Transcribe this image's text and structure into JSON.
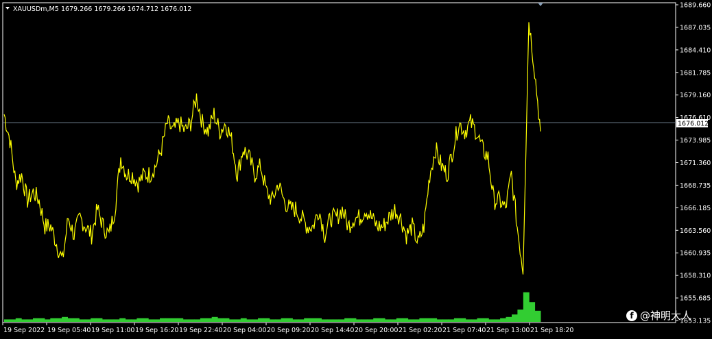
{
  "header": {
    "symbol_label": "XAUUSDm,M5",
    "ohlc": "1679.266 1679.266 1674.712 1676.012",
    "collapse_icon": "triangle-down-icon"
  },
  "watermark": {
    "icon": "facebook-icon",
    "text": "@神明大人"
  },
  "colors": {
    "background": "#000000",
    "price_line": "#FFFF00",
    "volume": "#32CD32",
    "grid_frame": "#FFFFFF",
    "current_price_line": "#708090"
  },
  "chart_data": {
    "type": "line",
    "title": "XAUUSDm,M5",
    "current_price": 1676.012,
    "ylim": [
      1653.1,
      1689.66
    ],
    "y_ticks": [
      "1689.660",
      "1687.035",
      "1684.410",
      "1681.785",
      "1679.160",
      "1676.610",
      "1673.985",
      "1671.360",
      "1668.735",
      "1666.185",
      "1663.560",
      "1660.935",
      "1658.310",
      "1655.685",
      "1653.135"
    ],
    "x_ticks": [
      "19 Sep 2022",
      "19 Sep 05:40",
      "19 Sep 11:00",
      "19 Sep 16:20",
      "19 Sep 22:40",
      "20 Sep 04:00",
      "20 Sep 09:20",
      "20 Sep 14:40",
      "20 Sep 20:00",
      "21 Sep 02:20",
      "21 Sep 07:40",
      "21 Sep 13:00",
      "21 Sep 18:20"
    ],
    "series": [
      {
        "values": [
          1677,
          1674,
          1669,
          1670,
          1667,
          1668,
          1667,
          1664,
          1664,
          1662,
          1660,
          1665,
          1663,
          1665,
          1664,
          1663,
          1666,
          1664,
          1663,
          1666,
          1672,
          1670,
          1670,
          1669,
          1670,
          1670,
          1671,
          1673,
          1676,
          1675,
          1676,
          1675,
          1676,
          1679,
          1676,
          1675,
          1677,
          1675,
          1676,
          1674,
          1670,
          1673,
          1672,
          1670,
          1671,
          1668,
          1667,
          1669,
          1667,
          1666,
          1666,
          1665,
          1664,
          1664,
          1666,
          1663,
          1665,
          1665,
          1666,
          1664,
          1665,
          1665,
          1666,
          1665,
          1664,
          1664,
          1665,
          1666,
          1665,
          1663,
          1664,
          1662,
          1664,
          1670,
          1673,
          1671,
          1670,
          1673,
          1676,
          1675,
          1676,
          1675,
          1673,
          1672,
          1667,
          1667,
          1666,
          1670,
          1664,
          1659,
          1688,
          1682,
          1675
        ],
        "x_start": 0,
        "x_end": 785
      }
    ],
    "volume_series": [
      2,
      2,
      3,
      2,
      2,
      3,
      3,
      2,
      3,
      3,
      4,
      3,
      3,
      2,
      2,
      3,
      3,
      2,
      2,
      2,
      3,
      2,
      2,
      3,
      3,
      2,
      2,
      3,
      3,
      3,
      3,
      2,
      2,
      2,
      3,
      3,
      4,
      3,
      3,
      2,
      2,
      3,
      2,
      2,
      3,
      3,
      2,
      2,
      3,
      3,
      2,
      2,
      3,
      3,
      3,
      2,
      2,
      2,
      2,
      3,
      3,
      2,
      2,
      2,
      3,
      3,
      2,
      2,
      3,
      3,
      2,
      2,
      3,
      3,
      3,
      2,
      2,
      2,
      3,
      3,
      2,
      2,
      3,
      3,
      2,
      2,
      3,
      4,
      6,
      10,
      24,
      16,
      9
    ],
    "xlabel": "",
    "ylabel": ""
  }
}
